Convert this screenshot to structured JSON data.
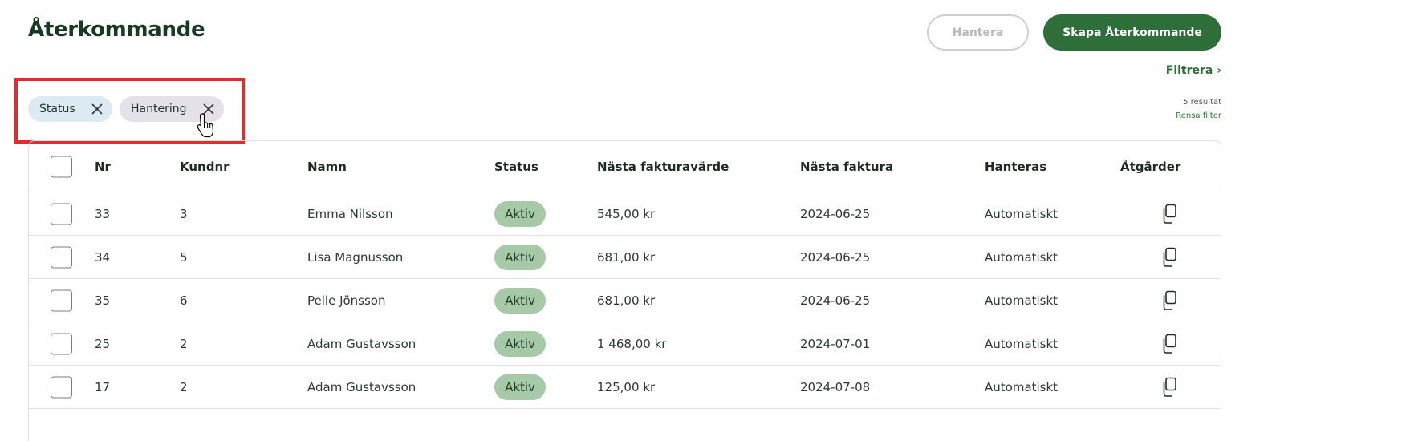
{
  "header": {
    "title": "Återkommande",
    "manage_label": "Hantera",
    "create_label": "Skapa Återkommande"
  },
  "filters": {
    "filter_link": "Filtrera ›",
    "results": "5 resultat",
    "clear": "Rensa filter",
    "chips": [
      {
        "label": "Status",
        "color": "#dcebf3"
      },
      {
        "label": "Hantering",
        "color": "#e4e2e8"
      }
    ]
  },
  "table": {
    "columns": [
      "Nr",
      "Kundnr",
      "Namn",
      "Status",
      "Nästa fakturavärde",
      "Nästa faktura",
      "Hanteras",
      "Åtgärder"
    ],
    "rows": [
      {
        "nr": "33",
        "kundnr": "3",
        "namn": "Emma Nilsson",
        "status": "Aktiv",
        "value": "545,00 kr",
        "date": "2024-06-25",
        "handled": "Automatiskt"
      },
      {
        "nr": "34",
        "kundnr": "5",
        "namn": "Lisa Magnusson",
        "status": "Aktiv",
        "value": "681,00 kr",
        "date": "2024-06-25",
        "handled": "Automatiskt"
      },
      {
        "nr": "35",
        "kundnr": "6",
        "namn": "Pelle Jönsson",
        "status": "Aktiv",
        "value": "681,00 kr",
        "date": "2024-06-25",
        "handled": "Automatiskt"
      },
      {
        "nr": "25",
        "kundnr": "2",
        "namn": "Adam Gustavsson",
        "status": "Aktiv",
        "value": "1 468,00 kr",
        "date": "2024-07-01",
        "handled": "Automatiskt"
      },
      {
        "nr": "17",
        "kundnr": "2",
        "namn": "Adam Gustavsson",
        "status": "Aktiv",
        "value": "125,00 kr",
        "date": "2024-07-08",
        "handled": "Automatiskt"
      }
    ]
  },
  "colors": {
    "accent": "#2e6e39",
    "highlight": "#e32b2b",
    "badge": "#a6c9a8"
  },
  "icons": {
    "row_action": "copy-icon",
    "chip_remove": "close-icon",
    "pointer": "hand-cursor-icon"
  }
}
